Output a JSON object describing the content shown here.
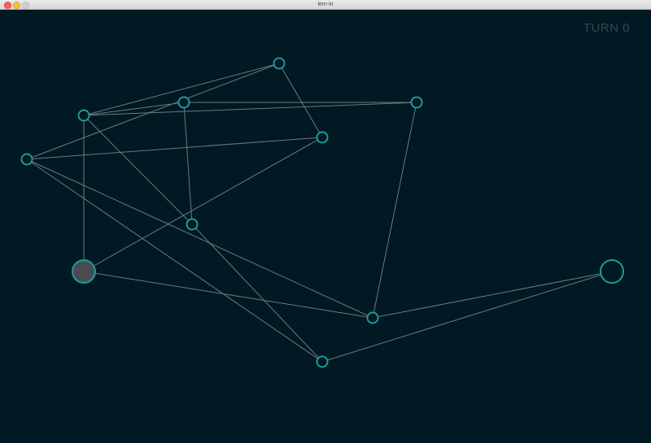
{
  "window": {
    "title": "lem-in"
  },
  "hud": {
    "turn_label": "TURN 0"
  },
  "colors": {
    "background": "#011923",
    "room_stroke": "#1f9a9b",
    "edge": "#6c7a80",
    "start_fill": "#4a4d50",
    "turn_text": "#344850"
  },
  "graph": {
    "rooms": [
      {
        "id": "r0",
        "type": "normal"
      },
      {
        "id": "r1",
        "type": "normal"
      },
      {
        "id": "r2",
        "type": "normal"
      },
      {
        "id": "r3",
        "type": "normal"
      },
      {
        "id": "r4",
        "type": "normal"
      },
      {
        "id": "r5",
        "type": "normal"
      },
      {
        "id": "r6",
        "type": "normal"
      },
      {
        "id": "r7",
        "type": "start"
      },
      {
        "id": "r8",
        "type": "end"
      },
      {
        "id": "r9",
        "type": "normal"
      },
      {
        "id": "r10",
        "type": "normal"
      }
    ],
    "links": [
      [
        "r0",
        "r3"
      ],
      [
        "r0",
        "r4"
      ],
      [
        "r0",
        "r5"
      ],
      [
        "r3",
        "r1"
      ],
      [
        "r3",
        "r2"
      ],
      [
        "r3",
        "r7"
      ],
      [
        "r3",
        "r6"
      ],
      [
        "r1",
        "r2"
      ],
      [
        "r1",
        "r6"
      ],
      [
        "r2",
        "r9"
      ],
      [
        "r5",
        "r4"
      ],
      [
        "r5",
        "r10"
      ],
      [
        "r6",
        "r10"
      ],
      [
        "r7",
        "r4"
      ],
      [
        "r7",
        "r9"
      ],
      [
        "r8",
        "r9"
      ],
      [
        "r8",
        "r10"
      ],
      [
        "r9",
        "r5"
      ]
    ]
  }
}
